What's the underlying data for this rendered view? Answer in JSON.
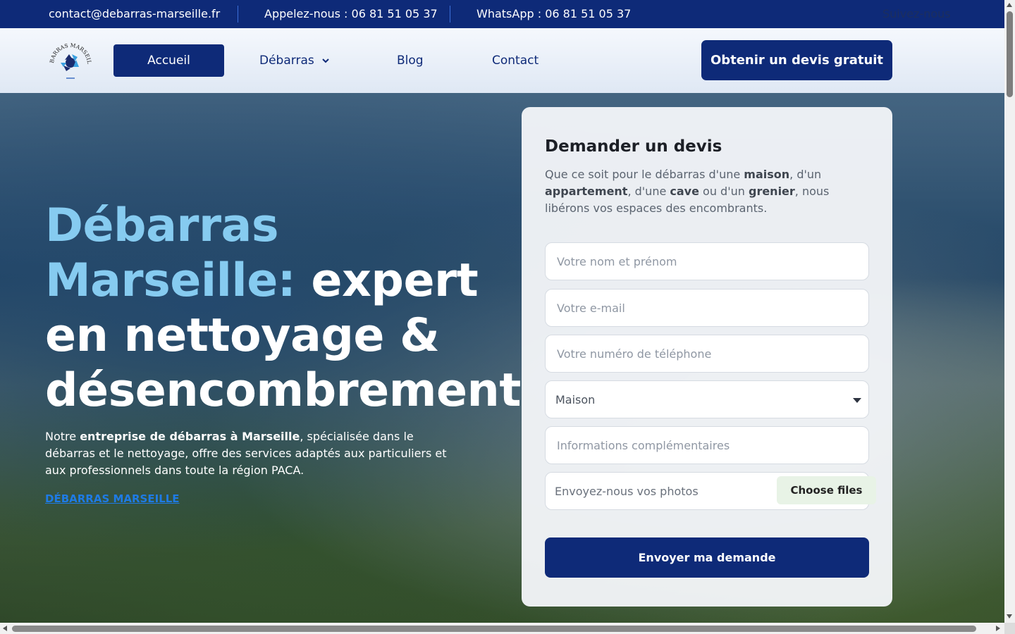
{
  "topbar": {
    "email": "contact@debarras-marseille.fr",
    "phone": "Appelez-nous : 06 81 51 05 37",
    "whatsapp": "WhatsApp : 06 81 51 05 37",
    "follow": "Suivez-nous"
  },
  "logo": {
    "text": "DÉBARRAS MARSEILLE",
    "icon": "recycle-icon"
  },
  "nav": {
    "home": "Accueil",
    "debarras": "Débarras",
    "blog": "Blog",
    "contact": "Contact",
    "cta": "Obtenir un devis gratuit"
  },
  "hero": {
    "title_highlight_1": "Débarras",
    "title_highlight_2": "Marseille:",
    "title_rest_1": " expert",
    "title_rest_2": "en nettoyage &",
    "title_rest_3": "désencombrement",
    "text_1": "Notre ",
    "text_bold": "entreprise de débarras à Marseille",
    "text_2": ", spécialisée dans le débarras et le nettoyage, offre des services adaptés aux particuliers et aux professionnels dans toute la région PACA.",
    "link": "DÉBARRAS MARSEILLE"
  },
  "form": {
    "title": "Demander un devis",
    "desc_1": "Que ce soit pour le débarras d'une ",
    "desc_b1": "maison",
    "desc_2": ", d'un ",
    "desc_b2": "appartement",
    "desc_3": ", d'une ",
    "desc_b3": "cave",
    "desc_4": " ou d'un ",
    "desc_b4": "grenier",
    "desc_5": ", nous libérons vos espaces des encombrants.",
    "name_placeholder": "Votre nom et prénom",
    "email_placeholder": "Votre e-mail",
    "phone_placeholder": "Votre numéro de téléphone",
    "type_selected": "Maison",
    "info_placeholder": "Informations complémentaires",
    "photos_label": "Envoyez-nous vos photos",
    "choose_files": "Choose files",
    "submit": "Envoyer ma demande"
  },
  "colors": {
    "primary": "#0e2a78",
    "highlight": "#86cbf0",
    "link": "#1e7be6"
  }
}
